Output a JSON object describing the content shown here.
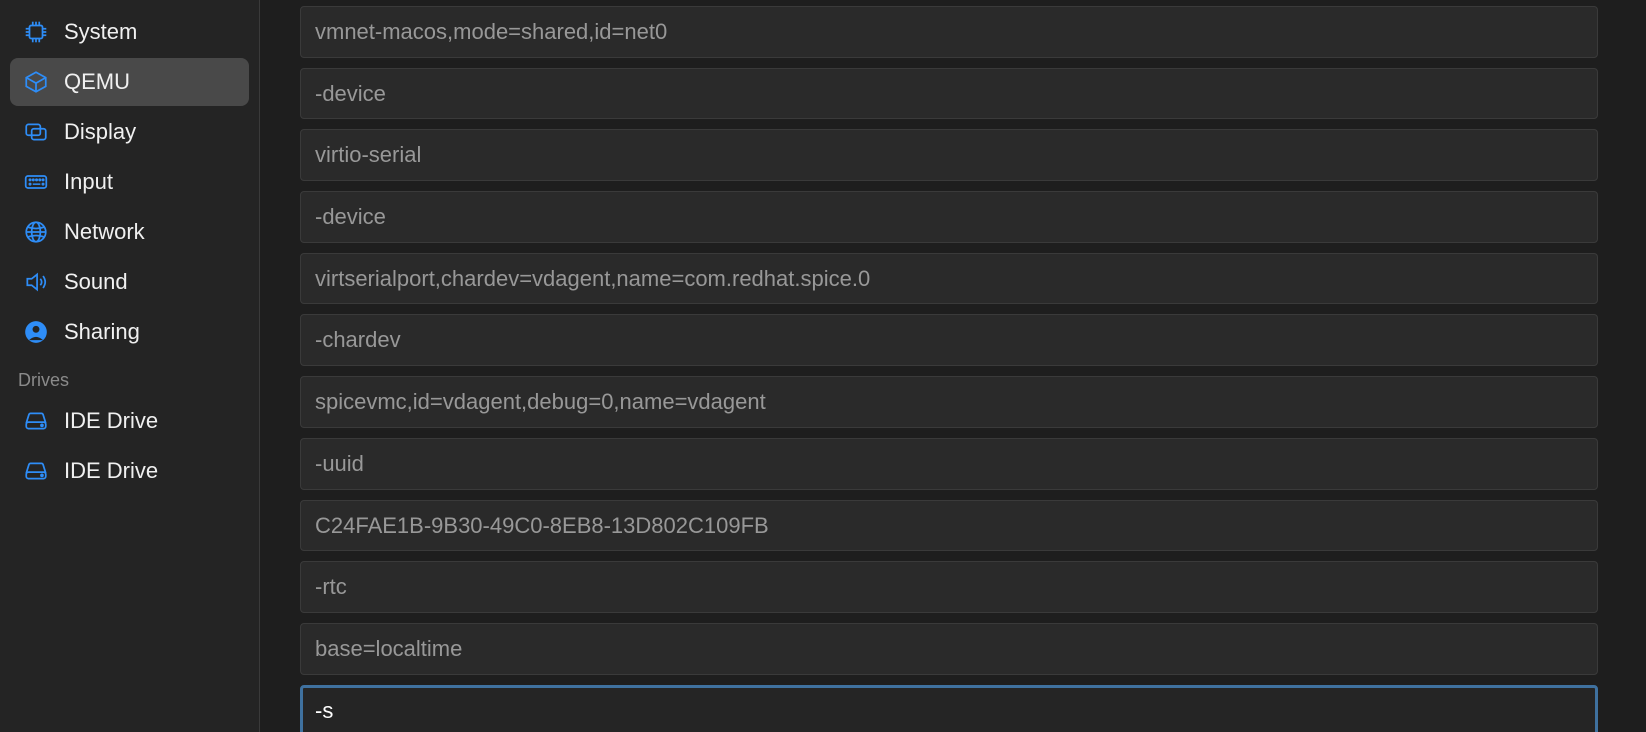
{
  "sidebar": {
    "main_items": [
      {
        "id": "system",
        "label": "System",
        "icon": "chip-icon"
      },
      {
        "id": "qemu",
        "label": "QEMU",
        "icon": "cube-icon",
        "selected": true
      },
      {
        "id": "display",
        "label": "Display",
        "icon": "display-icon"
      },
      {
        "id": "input",
        "label": "Input",
        "icon": "keyboard-icon"
      },
      {
        "id": "network",
        "label": "Network",
        "icon": "globe-icon"
      },
      {
        "id": "sound",
        "label": "Sound",
        "icon": "speaker-icon"
      },
      {
        "id": "sharing",
        "label": "Sharing",
        "icon": "user-icon"
      }
    ],
    "sections": [
      {
        "header": "Drives",
        "items": [
          {
            "id": "drive-0",
            "label": "IDE Drive",
            "icon": "drive-icon"
          },
          {
            "id": "drive-1",
            "label": "IDE Drive",
            "icon": "drive-icon"
          }
        ]
      }
    ]
  },
  "arguments": [
    {
      "value": "vmnet-macos,mode=shared,id=net0",
      "focused": false
    },
    {
      "value": "-device",
      "focused": false
    },
    {
      "value": "virtio-serial",
      "focused": false
    },
    {
      "value": "-device",
      "focused": false
    },
    {
      "value": "virtserialport,chardev=vdagent,name=com.redhat.spice.0",
      "focused": false
    },
    {
      "value": "-chardev",
      "focused": false
    },
    {
      "value": "spicevmc,id=vdagent,debug=0,name=vdagent",
      "focused": false
    },
    {
      "value": "-uuid",
      "focused": false
    },
    {
      "value": "C24FAE1B-9B30-49C0-8EB8-13D802C109FB",
      "focused": false
    },
    {
      "value": "-rtc",
      "focused": false
    },
    {
      "value": "base=localtime",
      "focused": false
    },
    {
      "value": "-s",
      "focused": true
    }
  ]
}
